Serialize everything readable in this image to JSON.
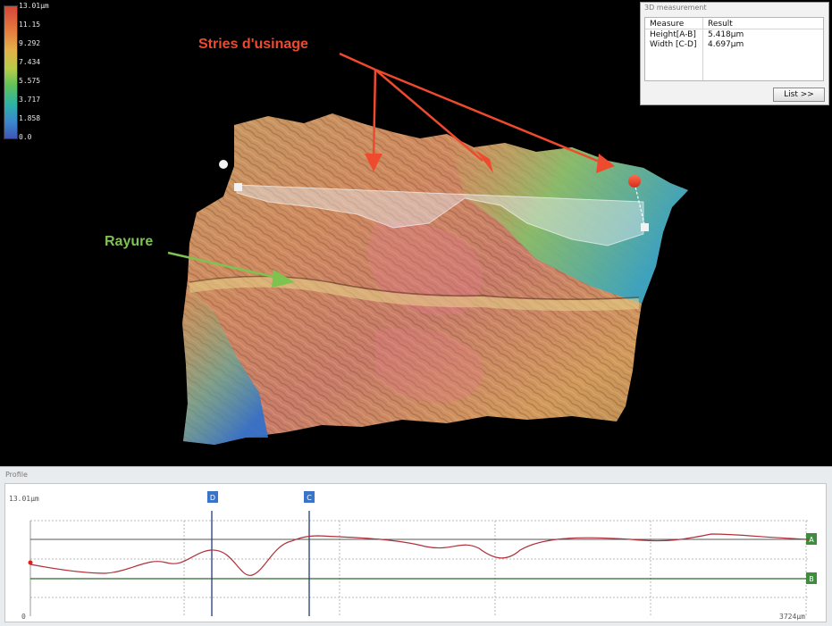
{
  "colorbar": {
    "labels": [
      "13.01µm",
      "11.15",
      "9.292",
      "7.434",
      "5.575",
      "3.717",
      "1.858",
      "0.0"
    ]
  },
  "annotations": {
    "stries": "Stries d'usinage",
    "rayure": "Rayure",
    "stries_color": "#ee4a2e",
    "rayure_color": "#7ec24f"
  },
  "measurement_panel": {
    "title": "3D measurement",
    "headers": {
      "measure": "Measure",
      "result": "Result"
    },
    "rows": [
      {
        "measure": "Height[A-B]",
        "result": "5.418µm"
      },
      {
        "measure": "Width [C-D]",
        "result": "4.697µm"
      }
    ],
    "list_button": "List >>"
  },
  "profile": {
    "title": "Profile",
    "y_top_label": "13.01µm",
    "x_start_label": "0",
    "x_end_label": "3724µm",
    "cursor_labels": [
      "D",
      "C"
    ],
    "marker_labels": [
      "A",
      "B"
    ]
  }
}
